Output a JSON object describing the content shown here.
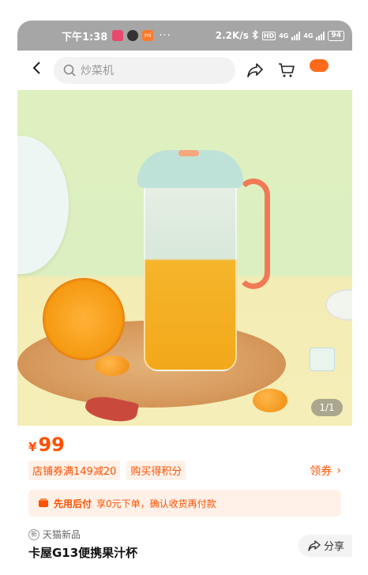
{
  "statusbar": {
    "time": "下午1:38",
    "dots": "···",
    "net_speed": "2.2K/s",
    "signal_tag_1": "4G",
    "signal_tag_2": "4G",
    "battery": "94"
  },
  "navbar": {
    "search_placeholder": "炒菜机"
  },
  "gallery": {
    "pager": "1/1"
  },
  "price": {
    "currency": "¥",
    "value": "99"
  },
  "coupons": {
    "tags": [
      "店铺券满149减20",
      "购买得积分"
    ],
    "claim_label": "领券",
    "chevron": "›"
  },
  "paylater": {
    "title": "先用后付",
    "desc": "享0元下单，确认收货再付款"
  },
  "product": {
    "badge_icon": "新",
    "badge": "天猫新品",
    "title": "卡屋G13便携果汁杯",
    "share_label": "分享"
  },
  "colors": {
    "accent": "#ff5000",
    "statusbar": "#a6a6a6"
  }
}
